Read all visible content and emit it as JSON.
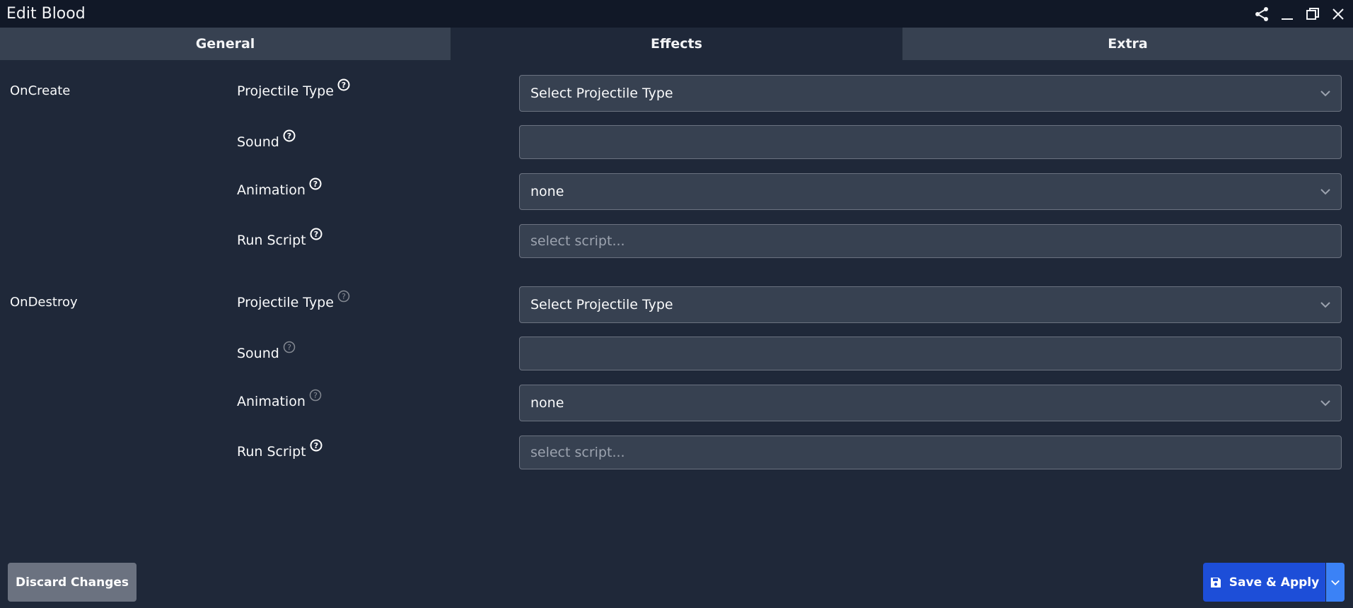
{
  "window": {
    "title": "Edit Blood",
    "controls": [
      "share-icon",
      "minimize-icon",
      "maximize-icon",
      "close-icon"
    ]
  },
  "tabs": [
    {
      "label": "General",
      "active": false
    },
    {
      "label": "Effects",
      "active": true
    },
    {
      "label": "Extra",
      "active": false
    }
  ],
  "sections": [
    {
      "name": "OnCreate",
      "fields": [
        {
          "label": "Projectile Type",
          "type": "select",
          "value": "Select Projectile Type",
          "placeholder": ""
        },
        {
          "label": "Sound",
          "type": "input",
          "value": "",
          "placeholder": ""
        },
        {
          "label": "Animation",
          "type": "select",
          "value": "none",
          "placeholder": ""
        },
        {
          "label": "Run Script",
          "type": "input",
          "value": "",
          "placeholder": "select script..."
        }
      ]
    },
    {
      "name": "OnDestroy",
      "fields": [
        {
          "label": "Projectile Type",
          "type": "select",
          "value": "Select Projectile Type",
          "placeholder": ""
        },
        {
          "label": "Sound",
          "type": "input",
          "value": "",
          "placeholder": ""
        },
        {
          "label": "Animation",
          "type": "select",
          "value": "none",
          "placeholder": ""
        },
        {
          "label": "Run Script",
          "type": "input",
          "value": "",
          "placeholder": "select script..."
        }
      ]
    }
  ],
  "footer": {
    "discard_label": "Discard Changes",
    "save_label": "Save & Apply"
  },
  "colors": {
    "background": "#1f2839",
    "titlebar": "#111827",
    "control_bg": "#374151",
    "primary": "#1d4ed8",
    "secondary": "#6b7280"
  }
}
